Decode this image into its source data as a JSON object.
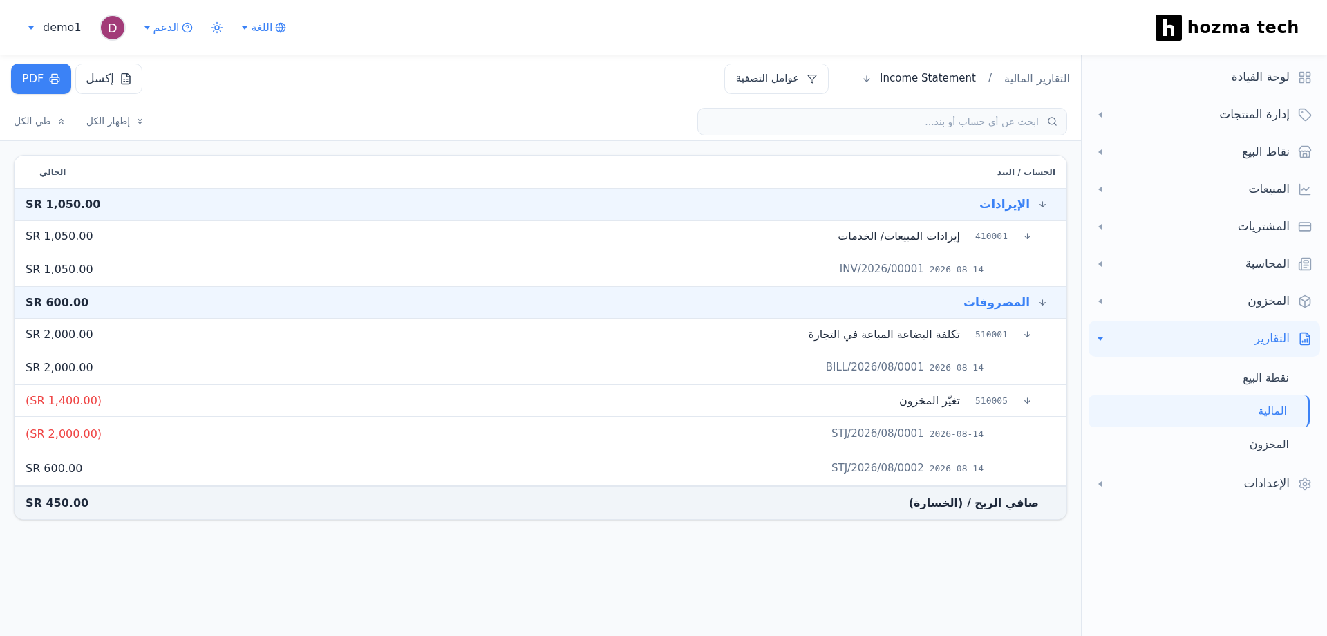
{
  "header": {
    "logo": "hozma tech",
    "language": "اللغة",
    "support": "الدعم",
    "avatar": "D",
    "user": "demo1"
  },
  "sidebar": {
    "items": [
      {
        "label": "لوحة القيادة",
        "has_children": false,
        "selected": false
      },
      {
        "label": "إدارة المنتجات",
        "has_children": true,
        "expanded": false,
        "selected": false
      },
      {
        "label": "نقاط البيع",
        "has_children": true,
        "expanded": false,
        "selected": false
      },
      {
        "label": "المبيعات",
        "has_children": true,
        "expanded": false,
        "selected": false
      },
      {
        "label": "المشتريات",
        "has_children": true,
        "expanded": false,
        "selected": false
      },
      {
        "label": "المحاسبة",
        "has_children": true,
        "expanded": false,
        "selected": false
      },
      {
        "label": "المخزون",
        "has_children": true,
        "expanded": false,
        "selected": false
      },
      {
        "label": "التقارير",
        "has_children": true,
        "expanded": true,
        "selected": true,
        "children": [
          {
            "label": "نقطة البيع",
            "selected": false
          },
          {
            "label": "المالية",
            "selected": true
          },
          {
            "label": "المخزون",
            "selected": false
          }
        ]
      },
      {
        "label": "الإعدادات",
        "has_children": true,
        "expanded": false,
        "selected": false
      }
    ]
  },
  "toolbar": {
    "breadcrumb": "التقارير المالية",
    "separator": "/",
    "report": "Income Statement",
    "filters": "عوامل التصفية",
    "excel": "إكسل",
    "pdf": "PDF"
  },
  "search": {
    "placeholder": "ابحث عن أي حساب أو بند..."
  },
  "expand_all": "إظهار الكل",
  "collapse_all": "طي الكل",
  "table": {
    "columns": [
      "الحساب / البند",
      "الحالي"
    ],
    "rows": [
      {
        "kind": "group",
        "label": "الإيرادات",
        "amount": "SR 1,050.00",
        "negative": false
      },
      {
        "kind": "account",
        "code": "410001",
        "label": "إيرادات المبيعات/ الخدمات",
        "amount": "SR 1,050.00",
        "negative": false
      },
      {
        "kind": "entry",
        "date": "2026-08-14",
        "label": "INV/2026/00001",
        "amount": "SR 1,050.00",
        "negative": false
      },
      {
        "kind": "group",
        "label": "المصروفات",
        "amount": "SR 600.00",
        "negative": false
      },
      {
        "kind": "account",
        "code": "510001",
        "label": "تكلفة البضاعة المباعة في التجارة",
        "amount": "SR 2,000.00",
        "negative": false
      },
      {
        "kind": "entry",
        "date": "2026-08-14",
        "label": "BILL/2026/08/0001",
        "amount": "SR 2,000.00",
        "negative": false
      },
      {
        "kind": "account",
        "code": "510005",
        "label": "تغيّر المخزون",
        "amount": "(SR 1,400.00)",
        "negative": true
      },
      {
        "kind": "entry",
        "date": "2026-08-14",
        "label": "STJ/2026/08/0001",
        "amount": "(SR 2,000.00)",
        "negative": true
      },
      {
        "kind": "entry",
        "date": "2026-08-14",
        "label": "STJ/2026/08/0002",
        "amount": "SR 600.00",
        "negative": false
      },
      {
        "kind": "total",
        "label": "صافي الربح / (الخسارة)",
        "amount": "SR 450.00",
        "negative": false
      }
    ]
  }
}
